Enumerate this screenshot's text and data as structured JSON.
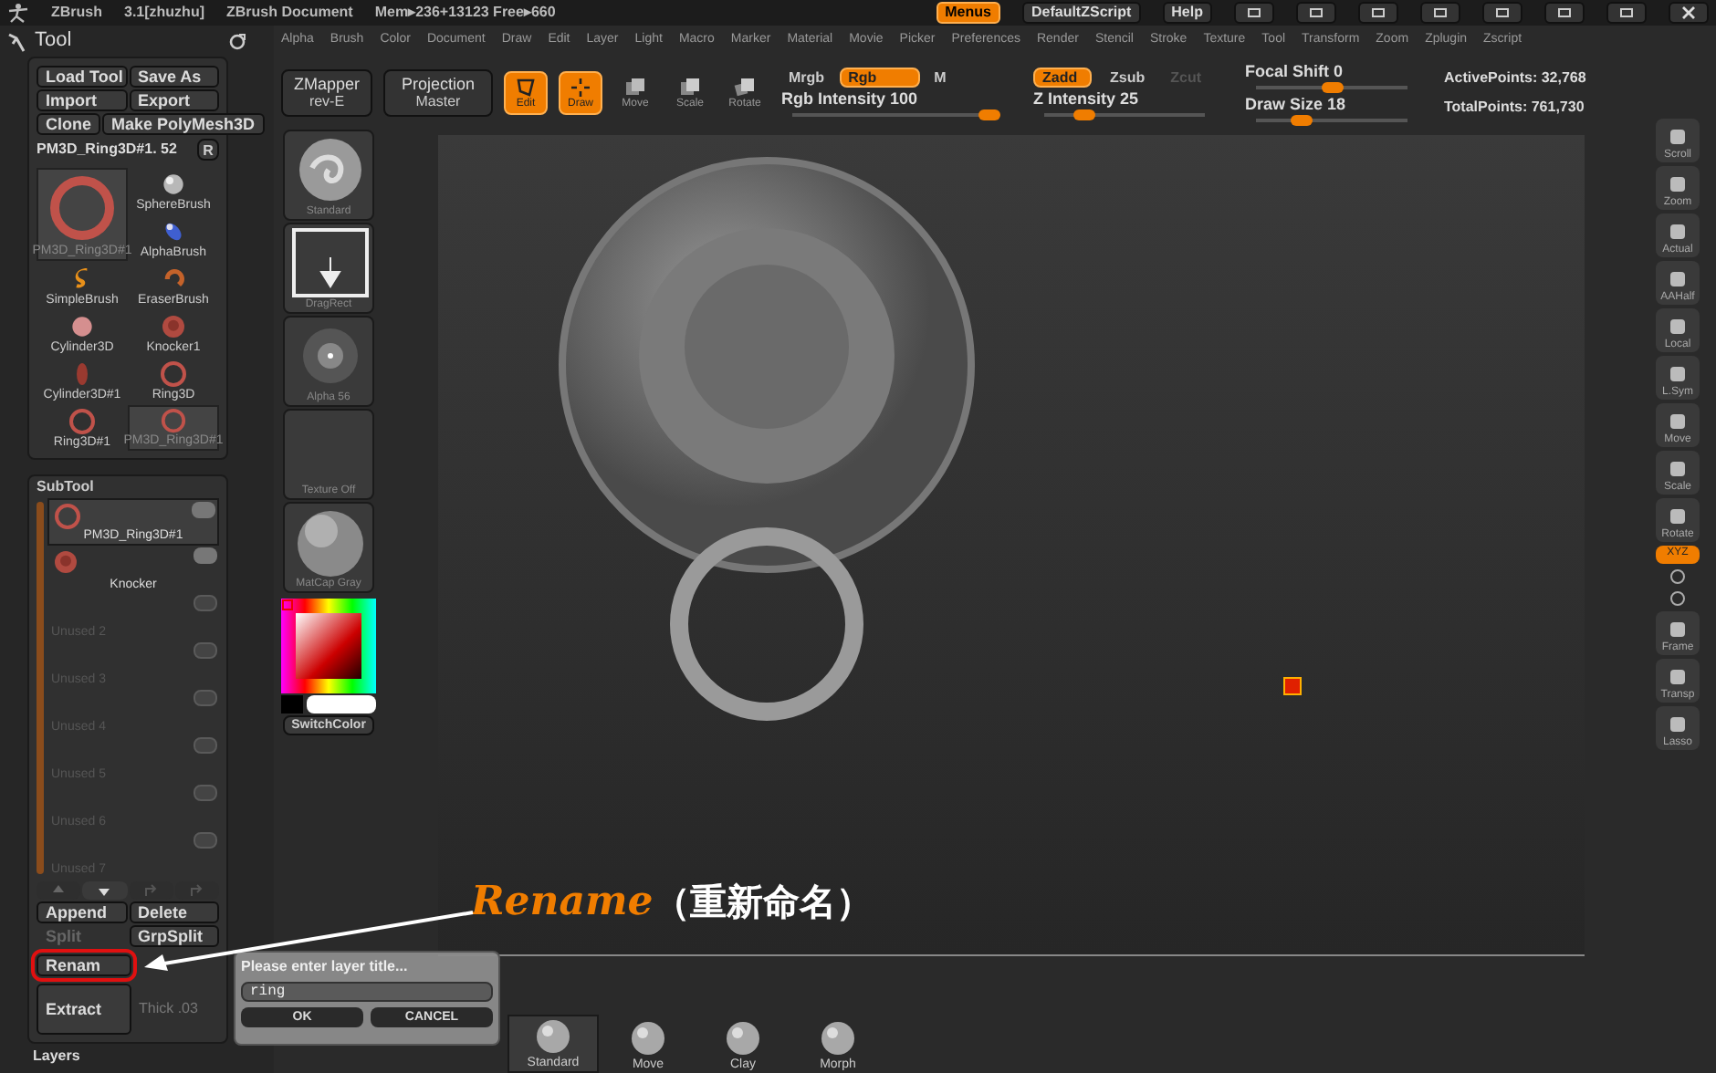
{
  "title_bar": {
    "app": "ZBrush",
    "version": "3.1[zhuzhu]",
    "document": "ZBrush Document",
    "memory": "Mem▸236+13123 Free▸660",
    "buttons": [
      {
        "label": "Menus",
        "selected": true
      },
      {
        "label": "DefaultZScript",
        "selected": false
      },
      {
        "label": "Help",
        "selected": false
      }
    ]
  },
  "menu": [
    "Alpha",
    "Brush",
    "Color",
    "Document",
    "Draw",
    "Edit",
    "Layer",
    "Light",
    "Macro",
    "Marker",
    "Material",
    "Movie",
    "Picker",
    "Preferences",
    "Render",
    "Stencil",
    "Stroke",
    "Texture",
    "Tool",
    "Transform",
    "Zoom",
    "Zplugin",
    "Zscript"
  ],
  "toolbar": {
    "zmapper": {
      "label": "ZMapper",
      "sub": "rev-E"
    },
    "projection": {
      "label": "Projection",
      "sub": "Master"
    },
    "modes": [
      {
        "kind": "edit",
        "label": "Edit",
        "selected": true
      },
      {
        "kind": "draw",
        "label": "Draw",
        "selected": true
      },
      {
        "kind": "move",
        "label": "Move",
        "selected": false
      },
      {
        "kind": "scale",
        "label": "Scale",
        "selected": false
      },
      {
        "kind": "rotate",
        "label": "Rotate",
        "selected": false
      }
    ],
    "color_modes": [
      {
        "label": "Mrgb",
        "selected": false
      },
      {
        "label": "Rgb",
        "selected": true
      },
      {
        "label": "M",
        "selected": false
      }
    ],
    "rgb_intensity": {
      "label": "Rgb Intensity 100",
      "level": 1.0
    },
    "z_modes": [
      {
        "label": "Zadd",
        "selected": true,
        "disabled": false
      },
      {
        "label": "Zsub",
        "selected": false,
        "disabled": false
      },
      {
        "label": "Zcut",
        "selected": false,
        "disabled": true
      }
    ],
    "z_intensity": {
      "label": "Z Intensity 25",
      "level": 0.25
    },
    "focal_shift": {
      "label": "Focal Shift 0",
      "level": 0.5
    },
    "draw_size": {
      "label": "Draw Size 18",
      "level": 0.3
    },
    "active_points": "ActivePoints: 32,768",
    "total_points": "TotalPoints: 761,730"
  },
  "tool_panel": {
    "title": "Tool",
    "buttons": [
      "Load Tool",
      "Save As",
      "Import",
      "Export",
      "Clone",
      "Make PolyMesh3D"
    ],
    "current": "PM3D_Ring3D#1. 52",
    "r_button": "R",
    "tools": [
      {
        "name": "SphereBrush",
        "kind": "sphere",
        "selected": false
      },
      {
        "name": "PM3D_Ring3D#1",
        "kind": "ring",
        "selected": true,
        "large": true
      },
      {
        "name": "AlphaBrush",
        "kind": "alpha",
        "selected": false
      },
      {
        "name": "SimpleBrush",
        "kind": "simple",
        "selected": false
      },
      {
        "name": "EraserBrush",
        "kind": "eraser",
        "selected": false
      },
      {
        "name": "Cylinder3D",
        "kind": "disc",
        "selected": false
      },
      {
        "name": "Knocker1",
        "kind": "knocker",
        "selected": false
      },
      {
        "name": "Cylinder3D#1",
        "kind": "ellipse",
        "selected": false
      },
      {
        "name": "Ring3D",
        "kind": "ring",
        "selected": false
      },
      {
        "name": "Ring3D#1",
        "kind": "ring",
        "selected": false
      },
      {
        "name": "PM3D_Ring3D#1",
        "kind": "ring",
        "selected": true
      }
    ]
  },
  "subtool": {
    "title": "SubTool",
    "items": [
      {
        "name": "PM3D_Ring3D#1",
        "kind": "ring",
        "selected": true
      },
      {
        "name": "Knocker",
        "kind": "knocker",
        "selected": false
      },
      {
        "name": "Unused 2",
        "kind": "empty",
        "selected": false
      },
      {
        "name": "Unused 3",
        "kind": "empty",
        "selected": false
      },
      {
        "name": "Unused 4",
        "kind": "empty",
        "selected": false
      },
      {
        "name": "Unused 5",
        "kind": "empty",
        "selected": false
      },
      {
        "name": "Unused 6",
        "kind": "empty",
        "selected": false
      },
      {
        "name": "Unused 7",
        "kind": "empty",
        "selected": false
      }
    ],
    "buttons": [
      {
        "label": "Append",
        "disabled": false
      },
      {
        "label": "Delete",
        "disabled": false
      },
      {
        "label": "Split",
        "disabled": true
      },
      {
        "label": "GrpSplit",
        "disabled": false
      }
    ],
    "rename": "Renam",
    "extract": "Extract",
    "thick": "Thick .03",
    "layers": "Layers"
  },
  "shelf_left": [
    {
      "label": "Standard",
      "kind": "brush"
    },
    {
      "label": "DragRect",
      "kind": "stroke"
    },
    {
      "label": "Alpha 56",
      "kind": "alpha"
    },
    {
      "label": "Texture Off",
      "kind": "texture"
    },
    {
      "label": "MatCap Gray",
      "kind": "material"
    }
  ],
  "switch_color": "SwitchColor",
  "shelf_right": [
    {
      "label": "Scroll",
      "selected": false
    },
    {
      "label": "Zoom",
      "selected": false
    },
    {
      "label": "Actual",
      "selected": false
    },
    {
      "label": "AAHalf",
      "selected": false
    },
    {
      "label": "Local",
      "selected": false
    },
    {
      "label": "L.Sym",
      "selected": false
    },
    {
      "label": "Move",
      "selected": false
    },
    {
      "label": "Scale",
      "selected": false
    },
    {
      "label": "Rotate",
      "selected": false
    },
    {
      "label": "XYZ",
      "selected": true
    },
    {
      "label": "Frame",
      "selected": false
    },
    {
      "label": "Transp",
      "selected": false
    },
    {
      "label": "Lasso",
      "selected": false
    }
  ],
  "bottom_brushes": [
    {
      "label": "Standard",
      "selected": true
    },
    {
      "label": "Move",
      "selected": false
    },
    {
      "label": "Clay",
      "selected": false
    },
    {
      "label": "Morph",
      "selected": false
    }
  ],
  "dialog": {
    "prompt": "Please enter layer title...",
    "value": "ring",
    "buttons": [
      "OK",
      "CANCEL"
    ]
  },
  "annotation": {
    "word": "Rename",
    "note": "（重新命名）"
  }
}
